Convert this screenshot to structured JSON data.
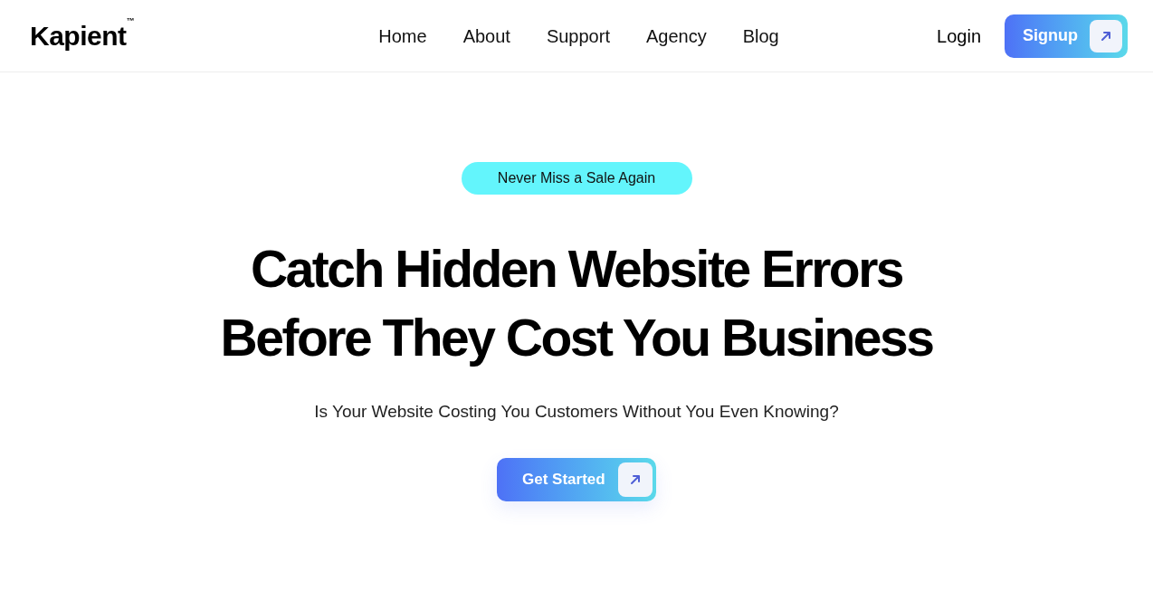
{
  "header": {
    "logo": {
      "text": "Kapient",
      "mark": "™"
    },
    "nav": [
      {
        "label": "Home"
      },
      {
        "label": "About"
      },
      {
        "label": "Support"
      },
      {
        "label": "Agency"
      },
      {
        "label": "Blog"
      }
    ],
    "login": "Login",
    "signup": "Signup"
  },
  "hero": {
    "badge": "Never Miss a Sale Again",
    "title_lines": [
      "Catch Hidden Website Errors",
      "Before They Cost You Business"
    ],
    "subtitle": "Is Your Website Costing You Customers Without You Even Knowing?",
    "cta": "Get Started"
  }
}
